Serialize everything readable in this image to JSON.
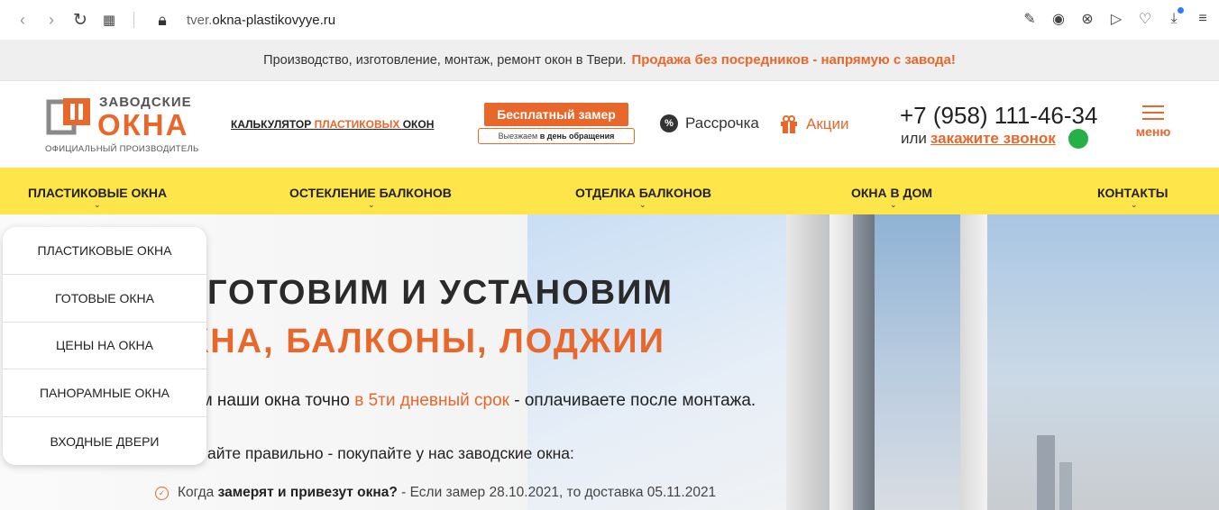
{
  "browser": {
    "url_prefix": "tver.",
    "url_domain": "okna-plastikovyye.ru",
    "icons": [
      "back-icon",
      "forward-icon",
      "reload-icon",
      "tabs-grid-icon",
      "lock-icon",
      "edit-icon",
      "camera-icon",
      "shield-x-icon",
      "send-icon",
      "heart-icon",
      "download-icon",
      "settings-icon"
    ]
  },
  "strip": {
    "text": "Производство, изготовление, монтаж, ремонт окон в Твери.",
    "accent": "Продажа без посредников - напрямую с завода!"
  },
  "header": {
    "logo": {
      "line1": "ЗАВОДСКИЕ",
      "line2": "ОКНА",
      "line3": "ОФИЦИАЛЬНЫЙ ПРОИЗВОДИТЕЛЬ"
    },
    "calc": {
      "part1": "КАЛЬКУЛЯТОР ",
      "part2": "ПЛАСТИКОВЫХ",
      "part3": " ОКОН"
    },
    "measure": {
      "button": "Бесплатный замер",
      "sub_pre": "Выезжаем ",
      "sub_bold": "в день обращения"
    },
    "installment": "Рассрочка",
    "promo": "Акции",
    "phone": "+7 (958) 111-46-34",
    "callback_pre": "или ",
    "callback_link": "закажите звонок",
    "menu_label": "меню"
  },
  "nav": {
    "items": [
      "ПЛАСТИКОВЫЕ ОКНА",
      "ОСТЕКЛЕНИЕ БАЛКОНОВ",
      "ОТДЕЛКА БАЛКОНОВ",
      "ОКНА В ДОМ",
      "КОНТАКТЫ"
    ]
  },
  "dropdown": {
    "items": [
      "ПЛАСТИКОВЫЕ ОКНА",
      "ГОТОВЫЕ ОКНА",
      "ЦЕНЫ НА ОКНА",
      "ПАНОРАМНЫЕ ОКНА",
      "ВХОДНЫЕ ДВЕРИ"
    ]
  },
  "hero": {
    "title1": "ГОТОВИМ И УСТАНОВИМ",
    "title2": "КНА, БАЛКОНЫ, ЛОДЖИИ",
    "p1_pre": "ем наши окна точно ",
    "p1_accent": "в 5ти дневный срок",
    "p1_post": " - оплачиваете после монтажа.",
    "p2": "айте правильно - покупайте у нас заводские окна:",
    "li_pre": "Когда ",
    "li_bold": "замерят и привезут окна?",
    "li_post": " - Если замер 28.10.2021, то доставка 05.11.2021"
  },
  "colors": {
    "accent": "#e8672a",
    "nav_bg": "#fde54a",
    "strip_bg": "#efefef"
  }
}
